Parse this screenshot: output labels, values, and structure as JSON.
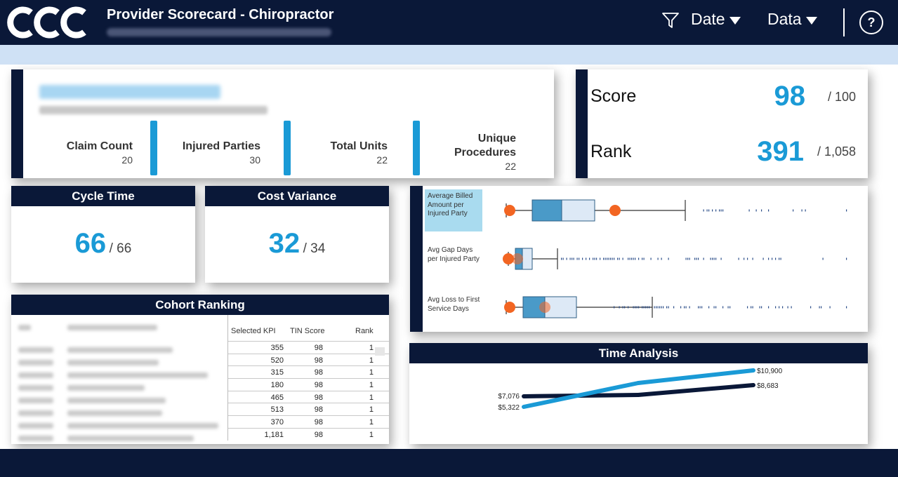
{
  "header": {
    "title": "Provider Scorecard - Chiropractor",
    "date_label": "Date",
    "data_label": "Data",
    "help_label": "?"
  },
  "colors": {
    "navy": "#0a1838",
    "accent": "#1a9ad6",
    "light_band": "#cfe1f5",
    "marker": "#f26522"
  },
  "provider": {
    "stats": [
      {
        "label": "Claim Count",
        "value": "20"
      },
      {
        "label": "Injured Parties",
        "value": "30"
      },
      {
        "label": "Total Units",
        "value": "22"
      },
      {
        "label_line1": "Unique",
        "label_line2": "Procedures",
        "value": "22"
      }
    ]
  },
  "score": {
    "score_label": "Score",
    "score_value": "98",
    "score_total": "/ 100",
    "rank_label": "Rank",
    "rank_value": "391",
    "rank_total": "/ 1,058"
  },
  "cycle_time": {
    "title": "Cycle Time",
    "value": "66",
    "total": "/ 66"
  },
  "cost_variance": {
    "title": "Cost Variance",
    "value": "32",
    "total": "/ 34"
  },
  "cohort": {
    "title": "Cohort Ranking",
    "columns": [
      "Selected KPI",
      "TIN Score",
      "Rank"
    ],
    "rows": [
      [
        "355",
        "98",
        "1"
      ],
      [
        "520",
        "98",
        "1"
      ],
      [
        "315",
        "98",
        "1"
      ],
      [
        "180",
        "98",
        "1"
      ],
      [
        "465",
        "98",
        "1"
      ],
      [
        "513",
        "98",
        "1"
      ],
      [
        "370",
        "98",
        "1"
      ],
      [
        "1,181",
        "98",
        "1"
      ]
    ]
  },
  "box_plots": {
    "labels": [
      "Average Billed Amount per Injured Party",
      "Avg Gap Days per Injured Party",
      "Avg Loss to First Service Days"
    ]
  },
  "time_analysis": {
    "title": "Time Analysis",
    "series": [
      {
        "start_label": "$5,322",
        "end_label": "$10,900"
      },
      {
        "start_label": "$7,076",
        "end_label": "$8,683"
      }
    ]
  }
}
